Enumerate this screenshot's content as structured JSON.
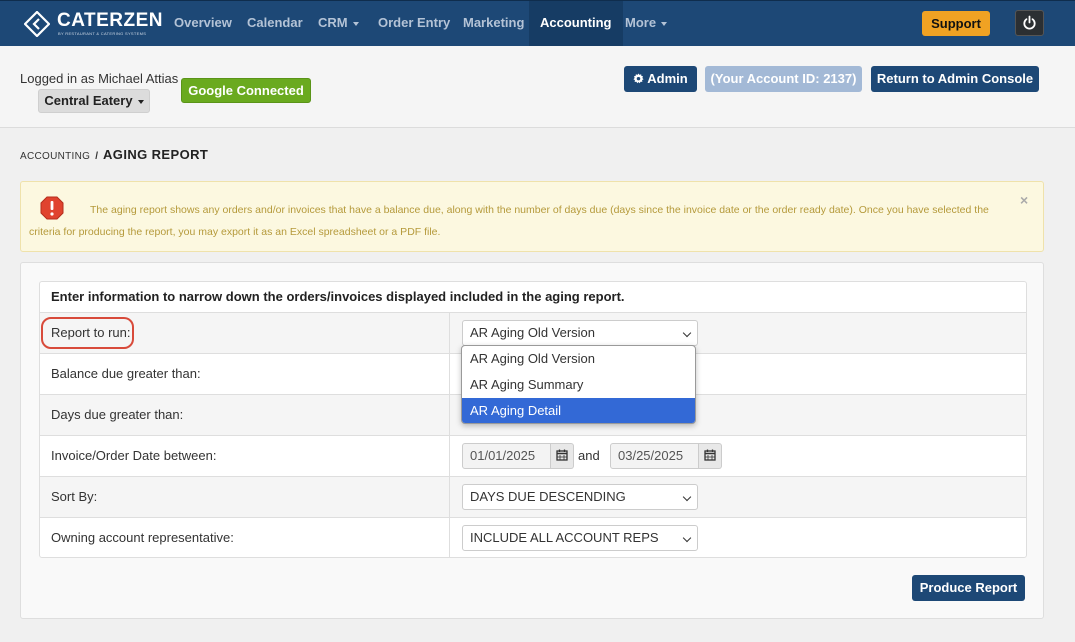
{
  "brand": {
    "name": "CATERZEN",
    "tagline": "BY RESTAURANT & CATERING SYSTEMS"
  },
  "nav": {
    "items": [
      "Overview",
      "Calendar",
      "CRM",
      "Order Entry",
      "Marketing",
      "Accounting",
      "More"
    ],
    "active": "Accounting",
    "support_label": "Support"
  },
  "account": {
    "logged_in_text": "Logged in as Michael Attias",
    "location": "Central Eatery",
    "google_label": "Google Connected",
    "admin_label": "Admin",
    "account_id_label": "(Your Account ID: 2137)",
    "return_label": "Return to Admin Console"
  },
  "breadcrumb": {
    "parent": "ACCOUNTING",
    "separator": "/",
    "current": "AGING REPORT"
  },
  "alert": {
    "text": "The aging report shows any orders and/or invoices that have a balance due, along with the number of days due (days since the invoice date or the order ready date). Once you have selected the criteria for producing the report, you may export it as an Excel spreadsheet or a PDF file.",
    "close": "×"
  },
  "form": {
    "heading": "Enter information to narrow down the orders/invoices displayed included in the aging report.",
    "rows": {
      "report": {
        "label": "Report to run:",
        "value": "AR Aging Old Version"
      },
      "balance": {
        "label": "Balance due greater than:"
      },
      "days": {
        "label": "Days due greater than:"
      },
      "dates": {
        "label": "Invoice/Order Date between:",
        "from": "01/01/2025",
        "and": "and",
        "to": "03/25/2025"
      },
      "sort": {
        "label": "Sort By:",
        "value": "DAYS DUE DESCENDING"
      },
      "rep": {
        "label": "Owning account representative:",
        "value": "INCLUDE ALL ACCOUNT REPS"
      }
    },
    "report_options": [
      "AR Aging Old Version",
      "AR Aging Summary",
      "AR Aging Detail"
    ],
    "highlighted_option": "AR Aging Detail",
    "submit_label": "Produce Report"
  },
  "colors": {
    "nav": "#1d4876",
    "support": "#f0a223",
    "google": "#6aaa1f",
    "highlight": "#d84a3a",
    "selected_option": "#3369d6"
  }
}
